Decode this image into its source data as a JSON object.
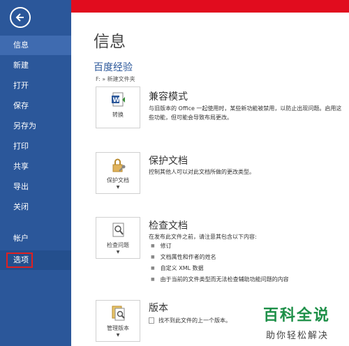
{
  "sidebar": {
    "items": [
      {
        "label": "信息"
      },
      {
        "label": "新建"
      },
      {
        "label": "打开"
      },
      {
        "label": "保存"
      },
      {
        "label": "另存为"
      },
      {
        "label": "打印"
      },
      {
        "label": "共享"
      },
      {
        "label": "导出"
      },
      {
        "label": "关闭"
      },
      {
        "label": "帐户"
      },
      {
        "label": "选项"
      }
    ]
  },
  "main": {
    "title": "信息",
    "doc_name": "百度经验",
    "doc_path": "F: » 新建文件夹",
    "compat": {
      "button": "转换",
      "title": "兼容模式",
      "desc": "与旧版本的 Office 一起使用时，某些新功能被禁用，以防止出现问题。启用这些功能，但可能会导致布局更改。"
    },
    "protect": {
      "button": "保护文档",
      "title": "保护文档",
      "desc": "控制其他人可以对此文档所做的更改类型。"
    },
    "inspect": {
      "button": "检查问题",
      "title": "检查文档",
      "desc": "在发布此文件之前，请注意其包含以下内容:",
      "bullets": [
        "修订",
        "文档属性和作者的姓名",
        "自定义 XML 数据",
        "由于当前的文件类型而无法检查辅助功能问题的内容"
      ]
    },
    "versions": {
      "button": "管理版本",
      "title": "版本",
      "desc": "找不到此文件的上一个版本。"
    }
  },
  "watermark": {
    "title": "百科全说",
    "subtitle": "助你轻松解决"
  },
  "colors": {
    "sidebar": "#2b579a",
    "accent_red": "#e10c1e",
    "watermark_green": "#1d8f48"
  },
  "icons": [
    "back-arrow-icon",
    "word-convert-icon",
    "lock-key-icon",
    "inspect-document-icon",
    "manage-versions-icon",
    "no-version-icon"
  ]
}
